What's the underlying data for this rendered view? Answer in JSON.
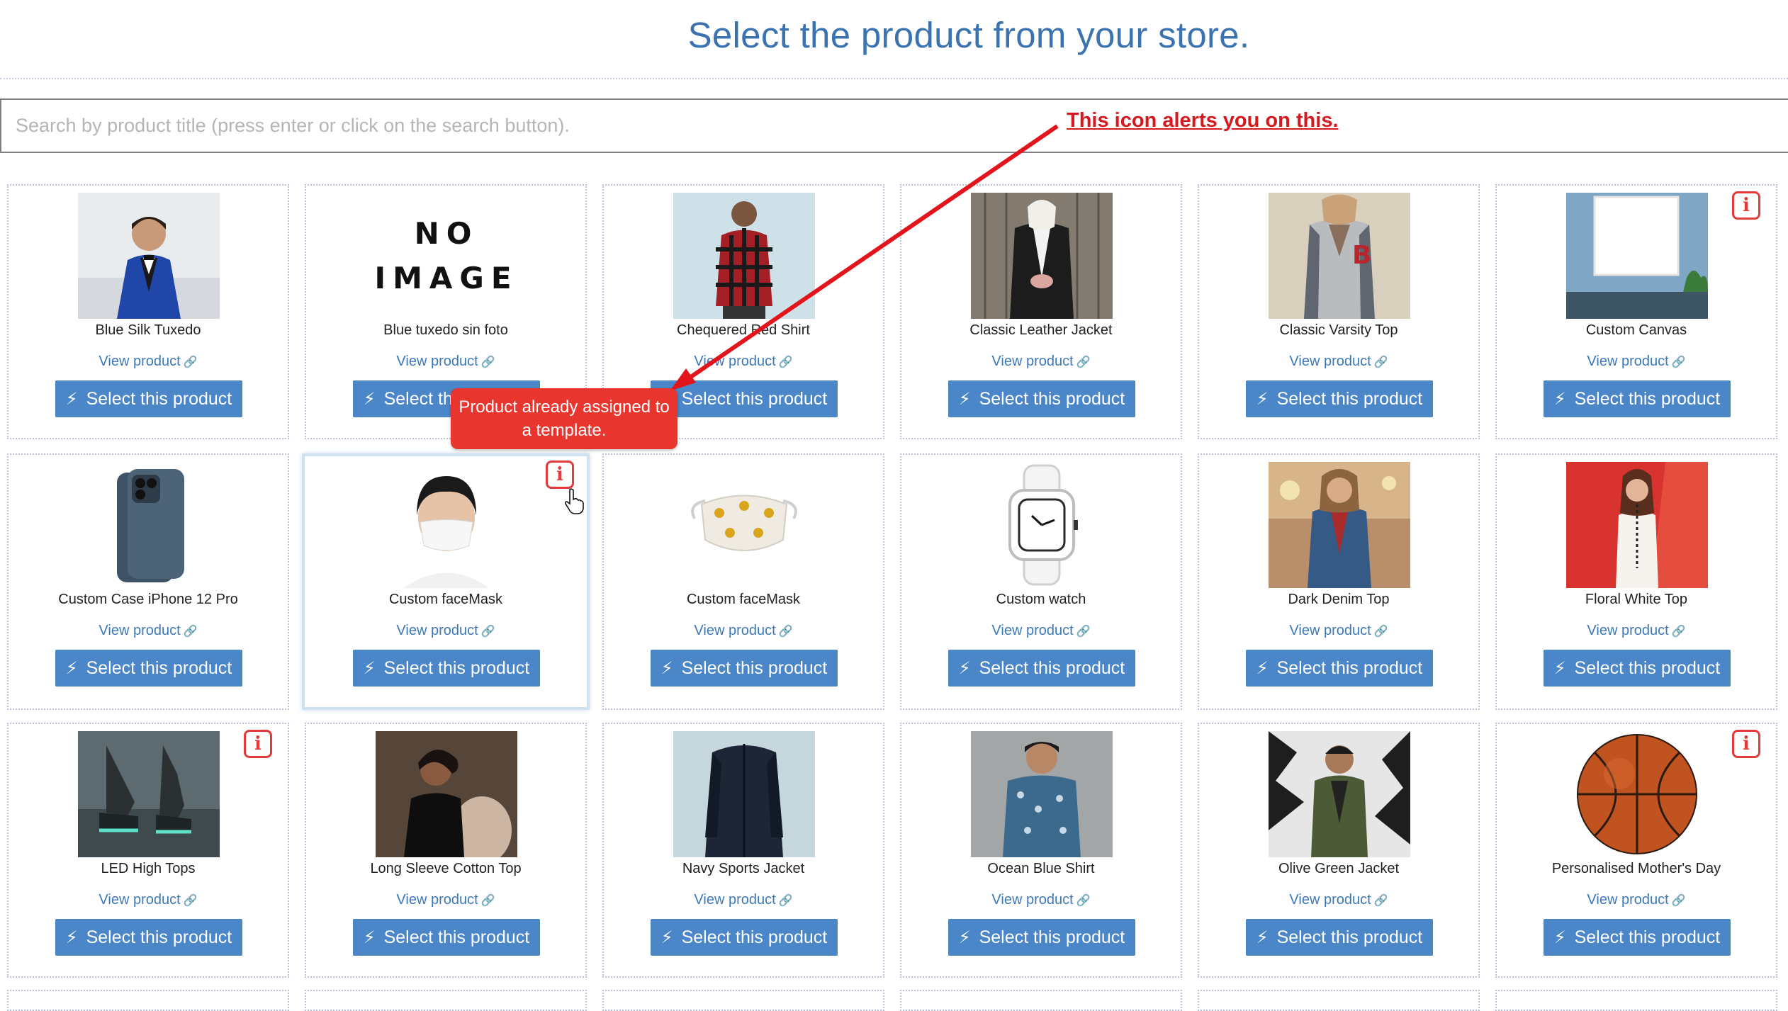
{
  "page": {
    "title": "Select the product from your store."
  },
  "search": {
    "placeholder": "Search by product title (press enter or click on the search button)."
  },
  "common": {
    "view_label": "View product",
    "select_label": "Select this product",
    "link_icon": "link-icon",
    "bolt_icon": "bolt-icon",
    "info_icon": "info-icon"
  },
  "annotation": {
    "text": "This icon alerts you on this.",
    "color": "#d6181f"
  },
  "tooltip": {
    "text": "Product already assigned to a template.",
    "color": "#e8352e"
  },
  "colors": {
    "accent": "#4a86c8",
    "title": "#3a73b0",
    "link": "#3d78b8",
    "alert": "#e23b3b"
  },
  "products": [
    {
      "name": "Blue Silk Tuxedo",
      "image": "man-blue-tuxedo",
      "assigned": false
    },
    {
      "name": "Blue tuxedo sin foto",
      "image": "no-image",
      "no_image_text": [
        "NO",
        "IMAGE"
      ],
      "assigned": false
    },
    {
      "name": "Chequered Red Shirt",
      "image": "red-plaid-shirt",
      "assigned": false
    },
    {
      "name": "Classic Leather Jacket",
      "image": "leather-jacket",
      "assigned": false
    },
    {
      "name": "Classic Varsity Top",
      "image": "varsity-jacket",
      "assigned": false
    },
    {
      "name": "Custom Canvas",
      "image": "canvas-on-wall",
      "assigned": true
    },
    {
      "name": "Custom Case iPhone 12 Pro",
      "image": "iphone-12-pro",
      "assigned": false
    },
    {
      "name": "Custom faceMask",
      "image": "woman-face-mask",
      "assigned": true
    },
    {
      "name": "Custom faceMask",
      "image": "printed-face-mask",
      "assigned": false
    },
    {
      "name": "Custom watch",
      "image": "white-watch",
      "assigned": false
    },
    {
      "name": "Dark Denim Top",
      "image": "woman-denim-jacket",
      "assigned": false
    },
    {
      "name": "Floral White Top",
      "image": "woman-white-top",
      "assigned": false
    },
    {
      "name": "LED High Tops",
      "image": "led-sneakers",
      "assigned": true
    },
    {
      "name": "Long Sleeve Cotton Top",
      "image": "woman-black-top",
      "assigned": false
    },
    {
      "name": "Navy Sports Jacket",
      "image": "navy-jacket",
      "assigned": false
    },
    {
      "name": "Ocean Blue Shirt",
      "image": "man-blue-shirt",
      "assigned": false
    },
    {
      "name": "Olive Green Jacket",
      "image": "olive-jacket",
      "assigned": false
    },
    {
      "name": "Personalised Mother's Day",
      "image": "basketball",
      "assigned": true
    }
  ]
}
